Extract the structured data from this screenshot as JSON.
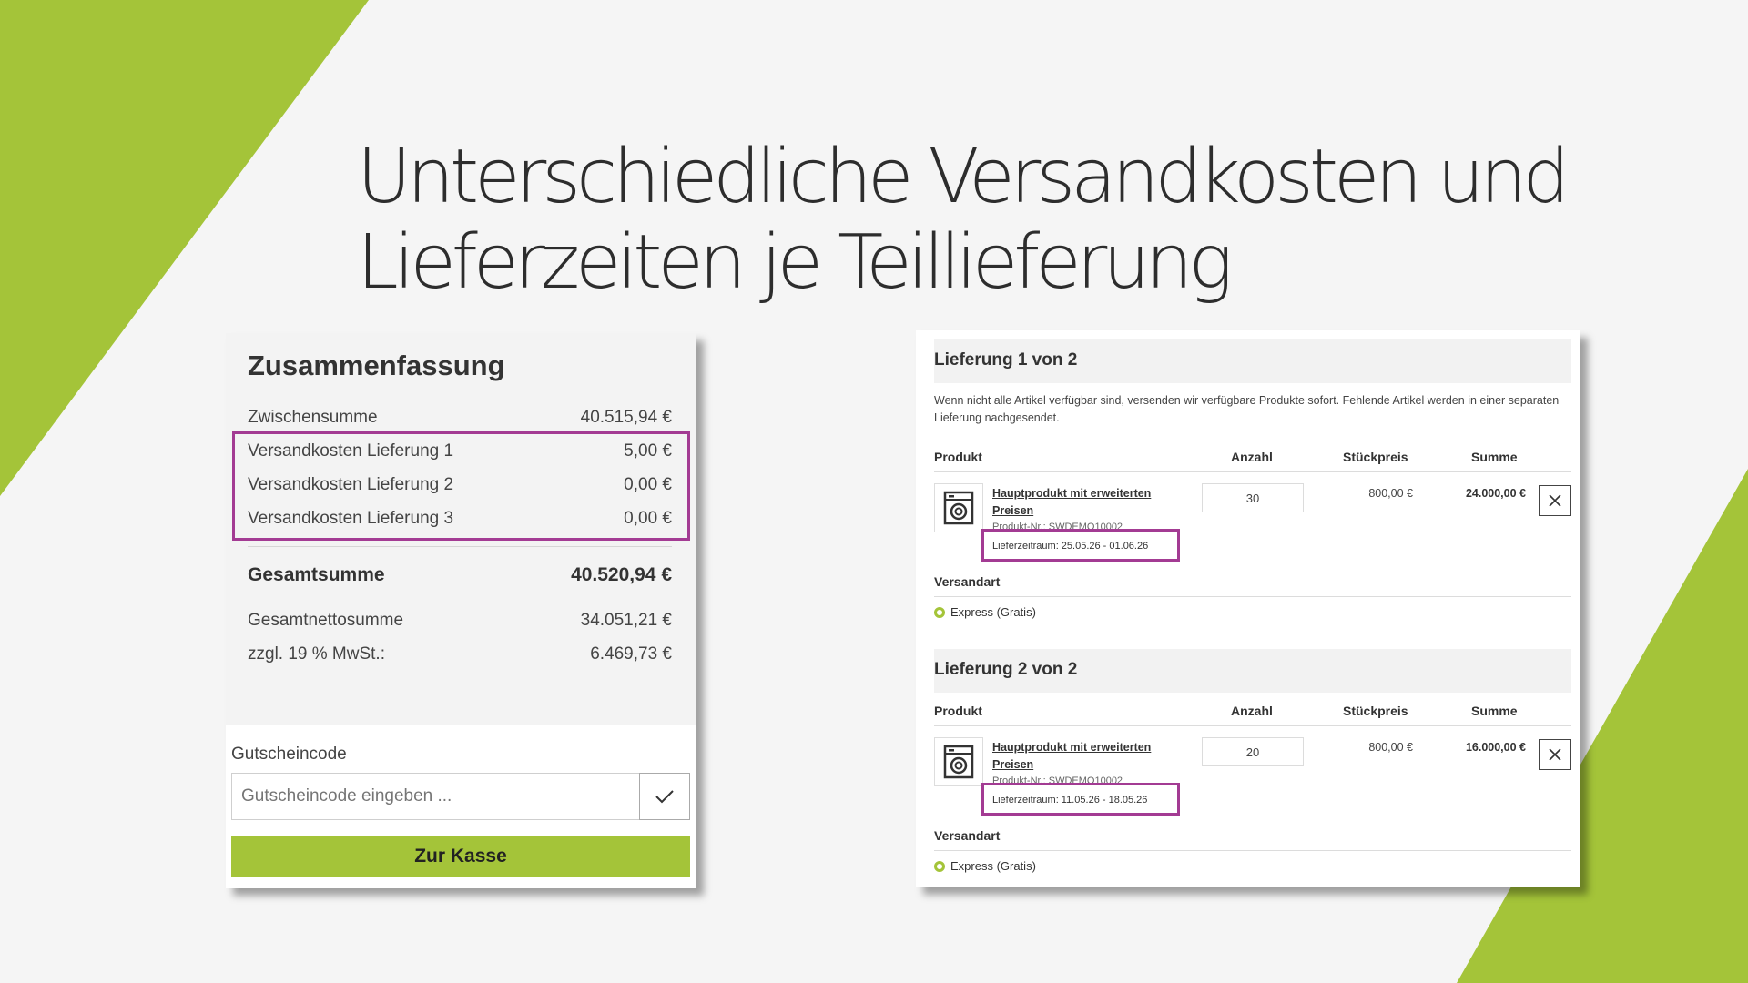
{
  "colors": {
    "accent_green": "#a4c439",
    "highlight_purple": "#a33b93",
    "background": "#f5f5f5"
  },
  "slide": {
    "title_line1": "Unterschiedliche Versandkosten und",
    "title_line2": "Lieferzeiten je Teillieferung"
  },
  "summary": {
    "heading": "Zusammenfassung",
    "rows": [
      {
        "label": "Zwischensumme",
        "value": "40.515,94 €"
      },
      {
        "label": "Versandkosten Lieferung 1",
        "value": "5,00 €"
      },
      {
        "label": "Versandkosten Lieferung 2",
        "value": "0,00 €"
      },
      {
        "label": "Versandkosten Lieferung 3",
        "value": "0,00 €"
      }
    ],
    "total": {
      "label": "Gesamtsumme",
      "value": "40.520,94 €"
    },
    "net": {
      "label": "Gesamtnettosumme",
      "value": "34.051,21 €"
    },
    "vat": {
      "label": "zzgl. 19 % MwSt.:",
      "value": "6.469,73 €"
    },
    "coupon_label": "Gutscheincode",
    "coupon_placeholder": "Gutscheincode eingeben ...",
    "checkout_label": "Zur Kasse"
  },
  "delivery": {
    "note": "Wenn nicht alle Artikel verfügbar sind, versenden wir verfügbare Produkte sofort. Fehlende Artikel werden in einer separaten Lieferung nachgesendet.",
    "columns": {
      "product": "Produkt",
      "qty": "Anzahl",
      "unit_price": "Stückpreis",
      "sum": "Summe"
    },
    "shipping_label": "Versandart",
    "shipments": [
      {
        "heading": "Lieferung 1 von 2",
        "product_name": "Hauptprodukt mit erweiterten Preisen",
        "product_nr": "Produkt-Nr.: SWDEMO10002",
        "lead_time": "Lieferzeitraum: 25.05.26 - 01.06.26",
        "qty": "30",
        "unit_price": "800,00 €",
        "sum": "24.000,00 €",
        "shipping_method": "Express (Gratis)"
      },
      {
        "heading": "Lieferung 2 von 2",
        "product_name": "Hauptprodukt mit erweiterten Preisen",
        "product_nr": "Produkt-Nr.: SWDEMO10002",
        "lead_time": "Lieferzeitraum: 11.05.26 - 18.05.26",
        "qty": "20",
        "unit_price": "800,00 €",
        "sum": "16.000,00 €",
        "shipping_method": "Express (Gratis)"
      }
    ]
  }
}
